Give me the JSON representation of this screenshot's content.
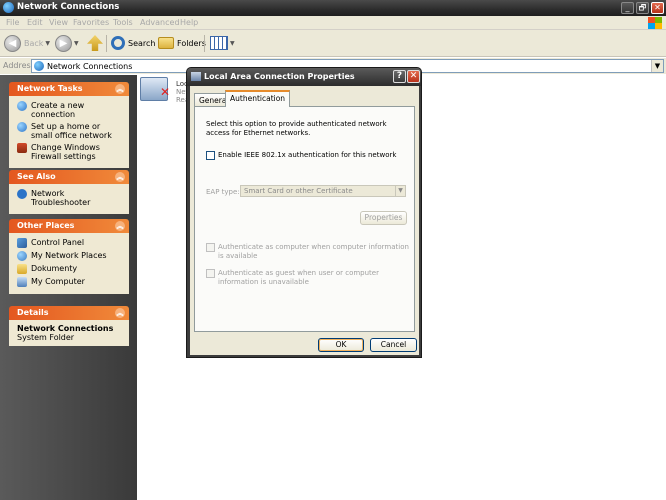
{
  "window": {
    "title": "Network Connections",
    "buttons": [
      "_",
      "🗗",
      "✕"
    ]
  },
  "menu": [
    "File",
    "Edit",
    "View",
    "Favorites",
    "Tools",
    "Advanced",
    "Help"
  ],
  "toolbar": {
    "back": "Back",
    "search": "Search",
    "folders": "Folders"
  },
  "address": {
    "label": "Address",
    "value": "Network Connections"
  },
  "sidebar": {
    "network_tasks": {
      "title": "Network Tasks",
      "items": [
        "Create a new connection",
        "Set up a home or small office network",
        "Change Windows Firewall settings"
      ]
    },
    "see_also": {
      "title": "See Also",
      "items": [
        "Network Troubleshooter"
      ]
    },
    "other_places": {
      "title": "Other Places",
      "items": [
        "Control Panel",
        "My Network Places",
        "Dokumenty",
        "My Computer"
      ]
    },
    "details": {
      "title": "Details",
      "name": "Network Connections",
      "type": "System Folder"
    }
  },
  "content": {
    "connection": {
      "line1": "Loc",
      "line2": "Net",
      "line3": "Rea"
    }
  },
  "dialog": {
    "title": "Local Area Connection Properties",
    "tabs": [
      "General",
      "Authentication"
    ],
    "description": "Select this option to provide authenticated network access for Ethernet networks.",
    "enable_8021x": "Enable IEEE 802.1x authentication for this network",
    "eap_label": "EAP type:",
    "eap_value": "Smart Card or other Certificate",
    "properties": "Properties",
    "auth_computer": "Authenticate as computer when computer information is available",
    "auth_guest": "Authenticate as guest when user or computer information is unavailable",
    "ok": "OK",
    "cancel": "Cancel"
  }
}
